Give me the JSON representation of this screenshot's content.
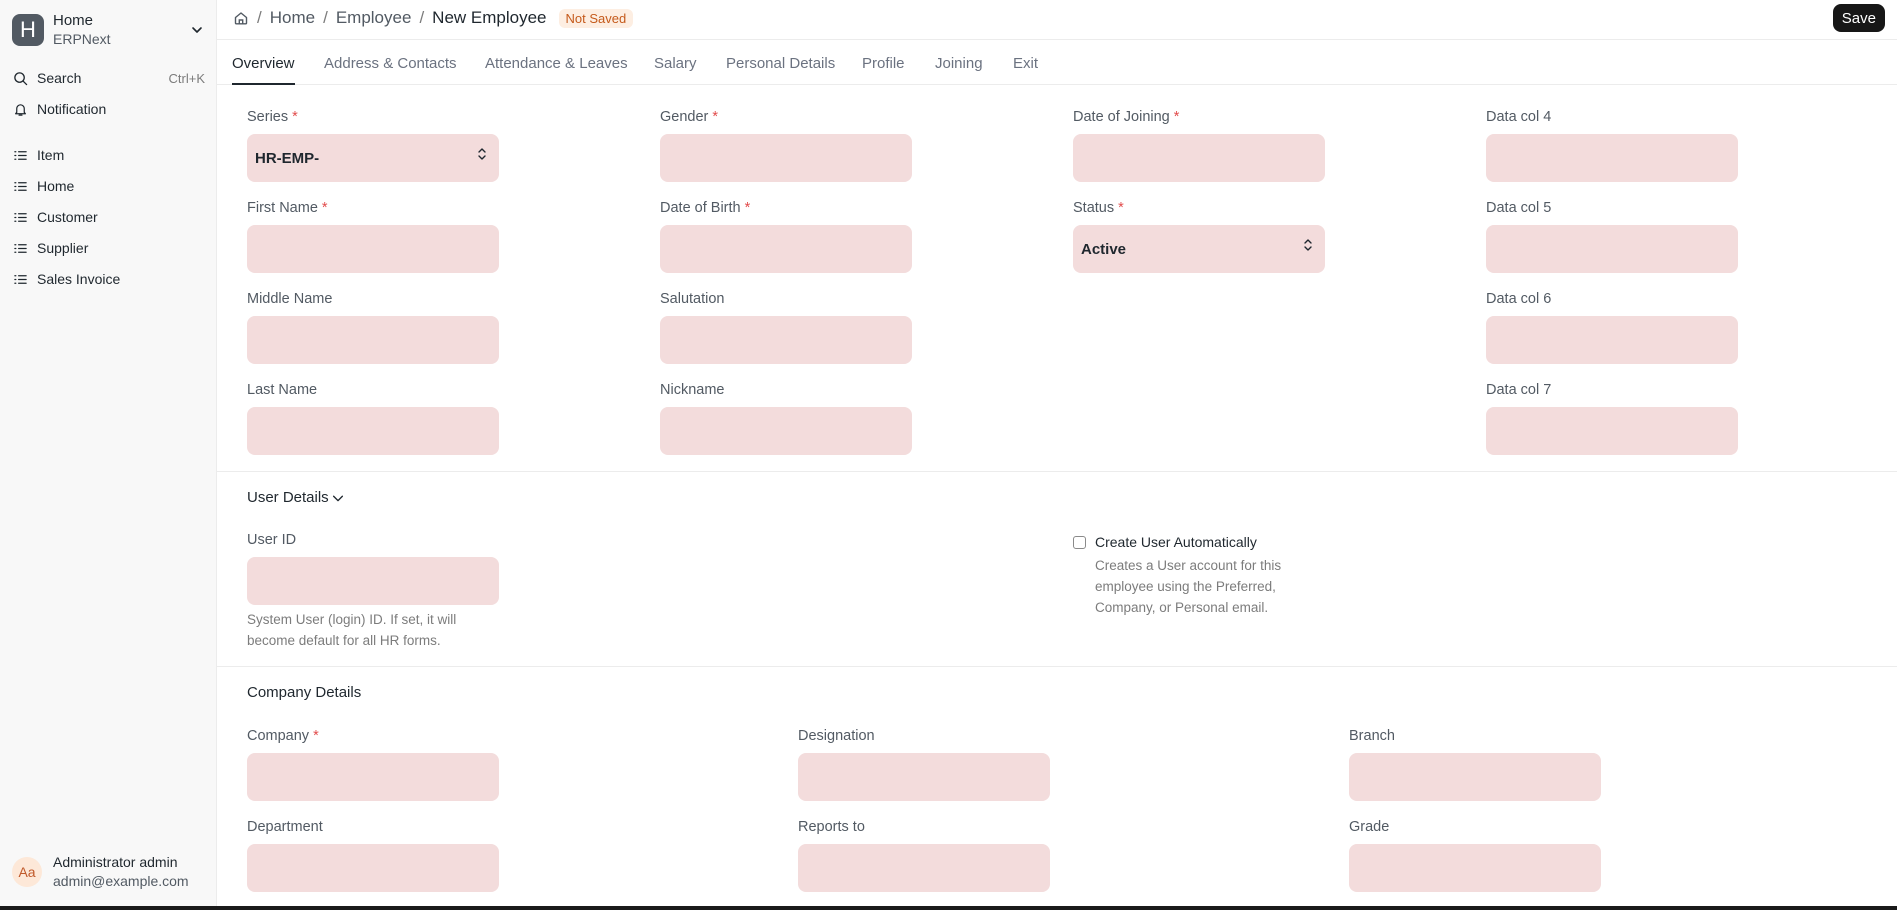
{
  "workspace": {
    "logo_letter": "H",
    "title": "Home",
    "subtitle": "ERPNext"
  },
  "sidebar": {
    "search_label": "Search",
    "search_shortcut": "Ctrl+K",
    "notification_label": "Notification",
    "items": [
      {
        "label": "Item"
      },
      {
        "label": "Home"
      },
      {
        "label": "Customer"
      },
      {
        "label": "Supplier"
      },
      {
        "label": "Sales Invoice"
      }
    ],
    "user": {
      "initials": "Aa",
      "name": "Administrator admin",
      "email": "admin@example.com"
    }
  },
  "header": {
    "breadcrumbs": [
      "Home",
      "Employee"
    ],
    "separator": "/",
    "current": "New Employee",
    "status_badge": "Not Saved",
    "save_label": "Save"
  },
  "tabs": [
    "Overview",
    "Address & Contacts",
    "Attendance & Leaves",
    "Salary",
    "Personal Details",
    "Profile",
    "Joining",
    "Exit"
  ],
  "required_mark": "*",
  "overview": {
    "series": {
      "label": "Series",
      "value": "HR-EMP-"
    },
    "first_name": {
      "label": "First Name"
    },
    "middle_name": {
      "label": "Middle Name"
    },
    "last_name": {
      "label": "Last Name"
    },
    "gender": {
      "label": "Gender"
    },
    "date_of_birth": {
      "label": "Date of Birth"
    },
    "salutation": {
      "label": "Salutation"
    },
    "nickname": {
      "label": "Nickname"
    },
    "date_of_joining": {
      "label": "Date of Joining"
    },
    "status": {
      "label": "Status",
      "value": "Active"
    },
    "data_col_4": {
      "label": "Data col 4"
    },
    "data_col_5": {
      "label": "Data col 5"
    },
    "data_col_6": {
      "label": "Data col 6"
    },
    "data_col_7": {
      "label": "Data col 7"
    }
  },
  "user_details": {
    "title": "User Details",
    "user_id": {
      "label": "User ID",
      "help": "System User (login) ID. If set, it will become default for all HR forms."
    },
    "create_user": {
      "label": "Create User Automatically",
      "help": "Creates a User account for this employee using the Preferred, Company, or Personal email.",
      "checked": false
    }
  },
  "company_details": {
    "title": "Company Details",
    "company": {
      "label": "Company"
    },
    "designation": {
      "label": "Designation"
    },
    "branch": {
      "label": "Branch"
    },
    "department": {
      "label": "Department"
    },
    "reports_to": {
      "label": "Reports to"
    },
    "grade": {
      "label": "Grade"
    }
  }
}
